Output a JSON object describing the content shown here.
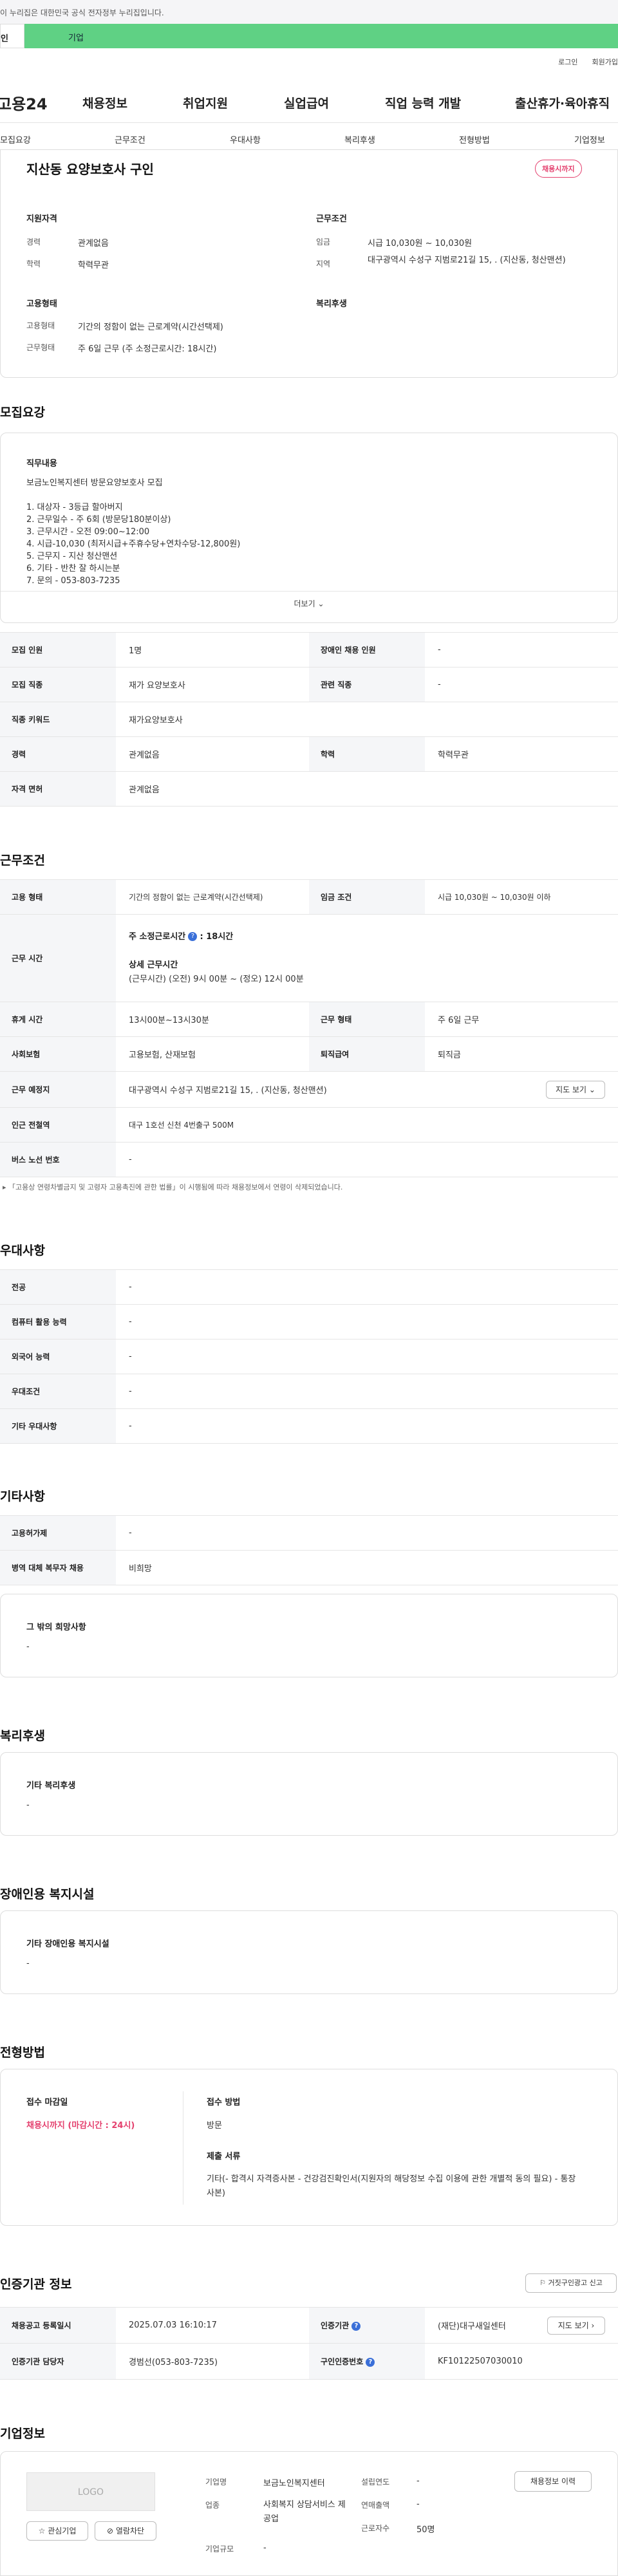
{
  "gov_banner": {
    "text": "이 누리집은 대한민국 공식 전자정부 누리집입니다."
  },
  "top_tabs": {
    "personal": "인",
    "company": "기업"
  },
  "util": {
    "login": "로그인",
    "signup": "회원가입"
  },
  "gnb": {
    "logo": "고용24",
    "items": [
      "채용정보",
      "취업지원",
      "실업급여",
      "직업 능력 개발",
      "출산휴가·육아휴직"
    ]
  },
  "anchor_nav": [
    "모집요강",
    "근무조건",
    "우대사항",
    "복리후생",
    "전형방법",
    "기업정보"
  ],
  "summary": {
    "title": "지산동 요양보호사 구인",
    "badge": "채용시까지",
    "qual_title": "지원자격",
    "career_label": "경력",
    "career_value": "관계없음",
    "edu_label": "학력",
    "edu_value": "학력무관",
    "work_title": "근무조건",
    "wage_label": "임금",
    "wage_value": "시급 10,030원 ~ 10,030원",
    "region_label": "지역",
    "region_value": "대구광역시 수성구 지범로21길 15, . (지산동, 청산맨션)",
    "employ_title": "고용형태",
    "type_label": "고용형태",
    "type_value": "기간의 정함이 없는 근로계약(시간선택제)",
    "hours_label": "근무형태",
    "hours_value": "주 6일 근무 (주 소정근로시간: 18시간)",
    "welfare_title": "복리후생"
  },
  "recruit": {
    "heading": "모집요강",
    "job_title": "직무내용",
    "job_desc": "보금노인복지센터  방문요양보호사 모집\n\n1. 대상자 - 3등급 할아버지\n2. 근무일수 - 주 6회 (방문당180분이상)\n3. 근무시간 - 오전 09:00~12:00\n4. 시급-10,030 (최저시급+주휴수당+연차수당-12,800원)\n5. 근무지 - 지산 청산맨션\n6. 기타 - 반찬 잘 하시는분\n7. 문의 - 053-803-7235",
    "more": "더보기",
    "rows": {
      "count_label": "모집 인원",
      "count_value": "1명",
      "disabled_label": "장애인 채용 인원",
      "disabled_value": "-",
      "job_label": "모집 직종",
      "job_value": "재가 요양보호사",
      "rel_label": "관련 직종",
      "rel_value": "-",
      "kw_label": "직종 키워드",
      "kw_value": "재가요양보호사",
      "career_label": "경력",
      "career_value": "관계없음",
      "edu_label": "학력",
      "edu_value": "학력무관",
      "license_label": "자격 면허",
      "license_value": "관계없음"
    }
  },
  "work": {
    "heading": "근무조건",
    "type_label": "고용 형태",
    "type_value": "기간의 정함이 없는 근로계약(시간선택제)",
    "wage_label": "임금 조건",
    "wage_value": "시급 10,030원 ~ 10,030원 이하",
    "time_label": "근무 시간",
    "time_main": "주 소정근로시간",
    "time_main_value": ": 18시간",
    "time_detail_title": "상세 근무시간",
    "time_detail": "(근무시간) (오전) 9시 00분 ~ (정오) 12시 00분",
    "rest_label": "휴게 시간",
    "rest_value": "13시00분~13시30분",
    "form_label": "근무 형태",
    "form_value": "주 6일 근무",
    "ins_label": "사회보험",
    "ins_value": "고용보험, 산재보험",
    "sev_label": "퇴직급여",
    "sev_value": "퇴직금",
    "place_label": "근무 예정지",
    "place_value": "대구광역시 수성구 지범로21길 15, . (지산동, 청산맨션)",
    "map_btn": "지도 보기",
    "subway_label": "인근 전철역",
    "subway_value": "대구 1호선 신천 4번출구 500M",
    "bus_label": "버스 노선 번호",
    "bus_value": "-",
    "note": "「고용상 연령차별금지 및 고령자 고용촉진에 관한 법률」이 시행됨에 따라 채용정보에서 연령이 삭제되었습니다."
  },
  "pref": {
    "heading": "우대사항",
    "rows": [
      {
        "label": "전공",
        "value": "-"
      },
      {
        "label": "컴퓨터 활용 능력",
        "value": "-"
      },
      {
        "label": "외국어 능력",
        "value": "-"
      },
      {
        "label": "우대조건",
        "value": "-"
      },
      {
        "label": "기타 우대사항",
        "value": "-"
      }
    ]
  },
  "etc": {
    "heading": "기타사항",
    "rows": [
      {
        "label": "고용허가제",
        "value": "-"
      },
      {
        "label": "병역 대체 복무자 채용",
        "value": "비희망"
      }
    ],
    "hope_title": "그 밖의 희망사항",
    "hope_value": "-"
  },
  "welfare": {
    "heading": "복리후생",
    "box_title": "기타 복리후생",
    "box_value": "-"
  },
  "disabled": {
    "heading": "장애인용 복지시설",
    "box_title": "기타 장애인용 복지시설",
    "box_value": "-"
  },
  "screening": {
    "heading": "전형방법",
    "deadline_title": "접수 마감일",
    "deadline_value": "채용시까지 (마감시간 : 24시)",
    "method_title": "접수 방법",
    "method_value": "방문",
    "docs_title": "제출 서류",
    "docs_value": "기타(- 합격시 자격증사본 - 건강검진확인서(지원자의 해당정보 수집 이용에 관한 개별적 동의 필요) - 통장사본)"
  },
  "cert": {
    "heading": "인증기관 정보",
    "report_btn": "거짓구인광고 신고",
    "reg_label": "채용공고 등록일시",
    "reg_value": "2025.07.03 16:10:17",
    "org_label": "인증기관",
    "org_value": "(재단)대구새일센터",
    "map_btn": "지도 보기",
    "mgr_label": "인증기관 담당자",
    "mgr_value": "경범선(053-803-7235)",
    "num_label": "구인인증번호",
    "num_value": "KF10122507030010"
  },
  "company": {
    "heading": "기업정보",
    "logo_text": "LOGO",
    "fav_btn": "관심기업",
    "block_btn": "열람차단",
    "name_label": "기업명",
    "name_value": "보금노인복지센터",
    "industry_label": "업종",
    "industry_value": "사회복지 상담서비스 제공업",
    "size_label": "기업규모",
    "size_value": "-",
    "year_label": "설립연도",
    "year_value": "-",
    "sales_label": "연매출액",
    "sales_value": "-",
    "emp_label": "근로자수",
    "emp_value": "50명",
    "history_btn": "채용정보 이력"
  }
}
